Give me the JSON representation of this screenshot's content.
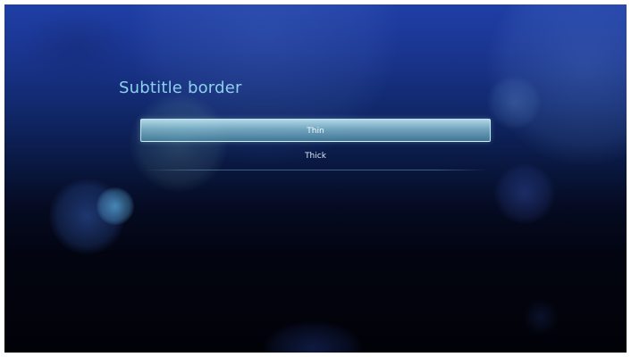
{
  "screen": {
    "title": "Subtitle border",
    "options": [
      {
        "label": "Thin",
        "selected": true
      },
      {
        "label": "Thick",
        "selected": false
      }
    ]
  },
  "colors": {
    "title": "#8fd0ee",
    "background_top": "#1f3fa6",
    "background_bottom": "#010208",
    "highlight": "#8cc8d7"
  }
}
